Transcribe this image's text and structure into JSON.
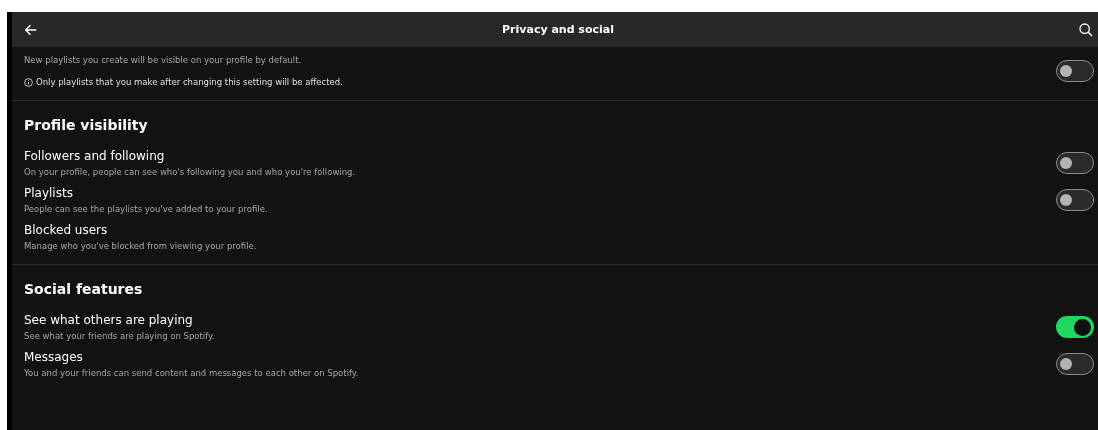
{
  "header": {
    "title": "Privacy and social"
  },
  "sections": [
    {
      "items": [
        {
          "description": "New playlists you create will be visible on your profile by default.",
          "note": "Only playlists that you make after changing this setting will be affected.",
          "on": false
        }
      ]
    },
    {
      "title": "Profile visibility",
      "items": [
        {
          "label": "Followers and following",
          "description": "On your profile, people can see who's following you and who you're following.",
          "on": false
        },
        {
          "label": "Playlists",
          "description": "People can see the playlists you've added to your profile.",
          "on": false
        },
        {
          "label": "Blocked users",
          "description": "Manage who you've blocked from viewing your profile."
        }
      ]
    },
    {
      "title": "Social features",
      "items": [
        {
          "label": "See what others are playing",
          "description": "See what your friends are playing on Spotify.",
          "on": true
        },
        {
          "label": "Messages",
          "description": "You and your friends can send content and messages to each other on Spotify.",
          "on": false
        }
      ]
    }
  ]
}
